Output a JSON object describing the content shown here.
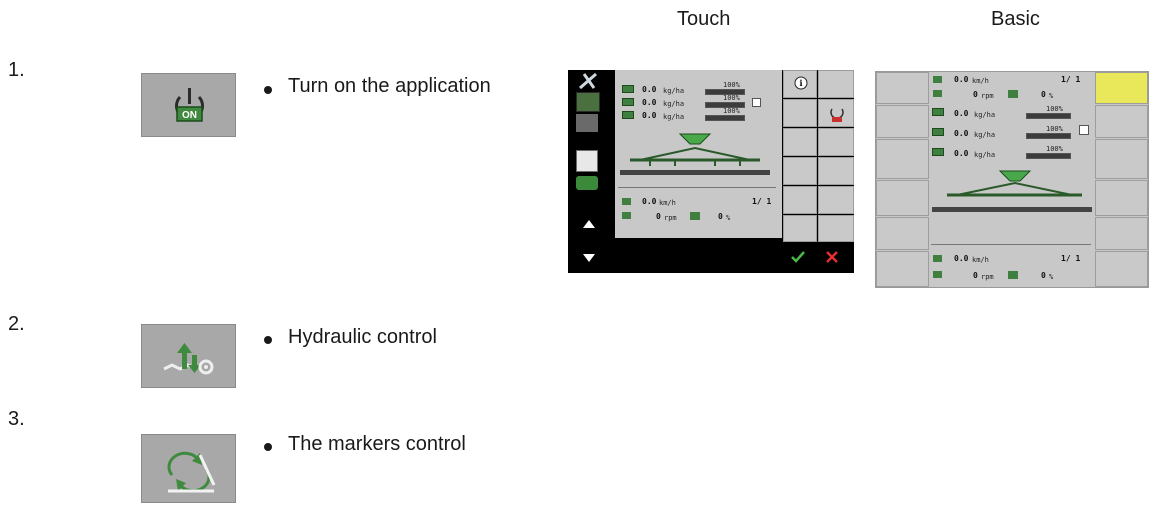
{
  "columns": {
    "touch": "Touch",
    "basic": "Basic"
  },
  "steps": [
    {
      "number": "1.",
      "icon": "power-on-icon",
      "description": "Turn on the application"
    },
    {
      "number": "2.",
      "icon": "hydraulic-control-icon",
      "description": "Hydraulic control"
    },
    {
      "number": "3.",
      "icon": "markers-control-icon",
      "description": "The markers control"
    }
  ],
  "power_badge": "ON",
  "touch_screen": {
    "rates": [
      "0.0",
      "0.0",
      "0.0"
    ],
    "rate_unit": "kg/ha",
    "bar_label": "100%",
    "speed": "0.0",
    "speed_unit": "km/h",
    "counter": "1/ 1",
    "rpm": "0",
    "rpm_unit": "rpm",
    "percent": "0",
    "percent_unit": "%",
    "colors": {
      "panel": "#c8c8c8",
      "sidebar": "#000000",
      "accept": "#49b849",
      "cancel": "#e03030"
    }
  },
  "basic_screen": {
    "speed": "0.0",
    "speed_unit": "km/h",
    "counter": "1/ 1",
    "rpm": "0",
    "rpm_unit": "rpm",
    "percent": "0",
    "percent_unit": "%",
    "rates": [
      "0.0",
      "0.0",
      "0.0"
    ],
    "rate_unit": "kg/ha",
    "bar_label": "100%"
  }
}
